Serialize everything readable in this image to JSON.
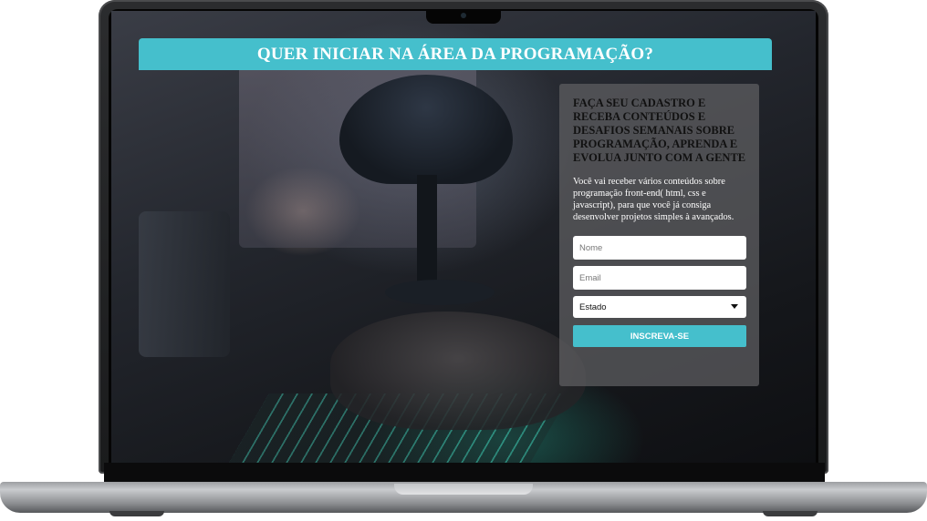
{
  "page": {
    "title": "QUER INICIAR NA ÁREA DA PROGRAMAÇÃO?"
  },
  "form": {
    "heading": "FAÇA SEU CADASTRO E RECEBA CONTEÚDOS E DESAFIOS SEMANAIS SOBRE PROGRAMAÇÃO, APRENDA E EVOLUA JUNTO COM A GENTE",
    "description": "Você vai receber vários conteúdos sobre programação front-end( html, css e javascript), para que você já consiga desenvolver projetos simples à avançados.",
    "name_placeholder": "Nome",
    "email_placeholder": "Email",
    "state_selected": "Estado",
    "submit_label": "INSCREVA-SE"
  },
  "colors": {
    "accent": "#45bfcc",
    "card_bg": "#5f5f62"
  },
  "icons": {
    "select_caret": "chevron-down-icon"
  }
}
